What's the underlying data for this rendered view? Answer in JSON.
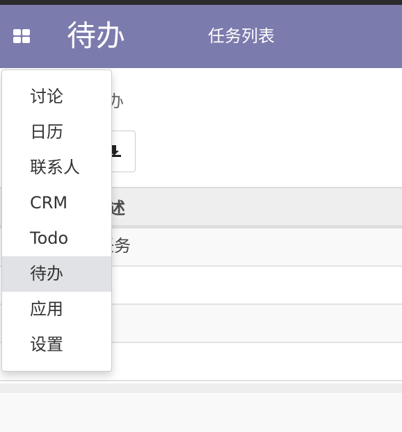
{
  "navbar": {
    "brand": "待办",
    "menu_link": "任务列表",
    "apps_icon": "apps-grid-icon",
    "color": "#7c7bad"
  },
  "breadcrumb": "办",
  "toolbar": {
    "download_icon": "download-icon"
  },
  "table": {
    "header": "述",
    "rows": [
      "任务",
      "",
      "",
      ""
    ]
  },
  "app_menu": {
    "items": [
      {
        "label": "讨论"
      },
      {
        "label": "日历"
      },
      {
        "label": "联系人"
      },
      {
        "label": "CRM"
      },
      {
        "label": "Todo"
      },
      {
        "label": "待办",
        "active": true
      },
      {
        "label": "应用"
      },
      {
        "label": "设置"
      }
    ]
  }
}
